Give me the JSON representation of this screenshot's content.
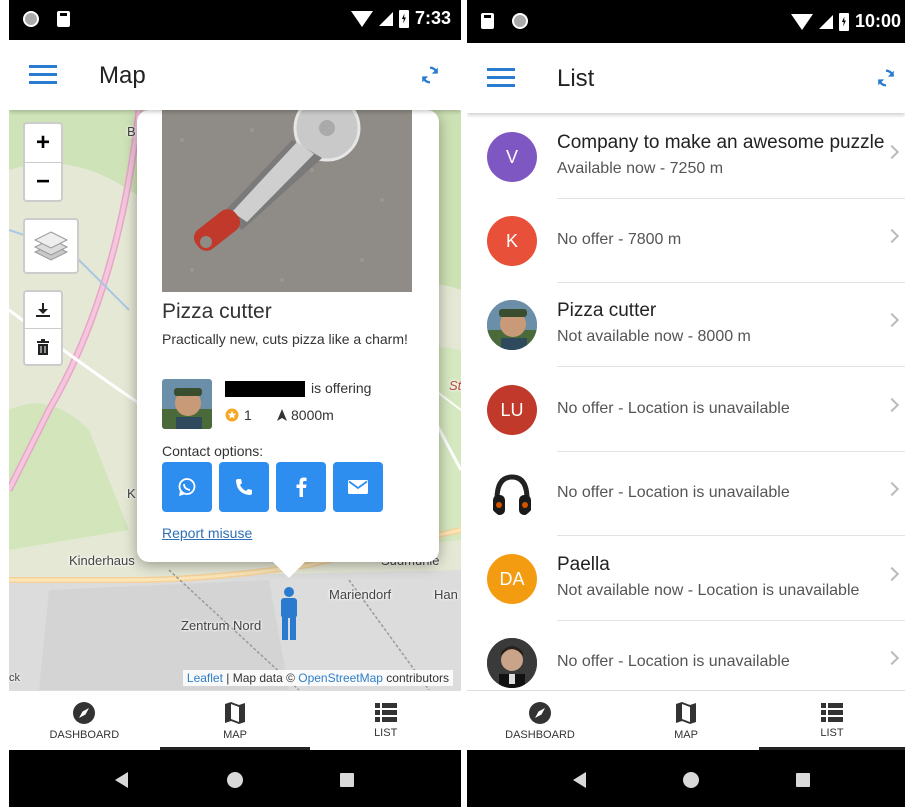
{
  "left": {
    "status": {
      "time": "7:33"
    },
    "appbar": {
      "title": "Map"
    },
    "map": {
      "zoom_in": "+",
      "zoom_out": "−",
      "labels": {
        "kinderhaus": "Kinderhaus",
        "zentrum": "Zentrum Nord",
        "mariendorf": "Mariendorf",
        "han": "Han",
        "sudmuhle": "Sudmühle",
        "b": "B",
        "k": "K",
        "st": "St",
        "ck": "ck"
      },
      "attribution": {
        "leaflet": "Leaflet",
        "sep": " | Map data © ",
        "osm": "OpenStreetMap",
        "tail": " contributors"
      }
    },
    "popup": {
      "title": "Pizza cutter",
      "description": "Practically new, cuts pizza like a charm!",
      "offering": "is offering",
      "rating": "1",
      "distance": "8000m",
      "contact_label": "Contact options:",
      "contact_buttons": [
        "whatsapp-icon",
        "phone-icon",
        "facebook-icon",
        "email-icon"
      ],
      "report": "Report misuse"
    }
  },
  "right": {
    "status": {
      "time": "10:00"
    },
    "appbar": {
      "title": "List"
    },
    "items": [
      {
        "initials": "V",
        "color": "#7e57c2",
        "title": "Company to make an awesome puzzle",
        "subtitle": "Available now - 7250 m"
      },
      {
        "initials": "K",
        "color": "#e8503a",
        "title": "",
        "subtitle": "No offer - 7800 m"
      },
      {
        "initials": "",
        "color": "#5a7a4a",
        "title": "Pizza cutter",
        "subtitle": "Not available now - 8000 m"
      },
      {
        "initials": "LU",
        "color": "#c0392b",
        "title": "",
        "subtitle": "No offer - Location is unavailable"
      },
      {
        "initials": "",
        "color": "#ffffff",
        "title": "",
        "subtitle": "No offer - Location is unavailable"
      },
      {
        "initials": "DA",
        "color": "#f39c12",
        "title": "Paella",
        "subtitle": "Not available now - Location is unavailable"
      },
      {
        "initials": "",
        "color": "#333333",
        "title": "",
        "subtitle": "No offer - Location is unavailable"
      }
    ]
  },
  "nav": {
    "dashboard": "DASHBOARD",
    "map": "MAP",
    "list": "LIST"
  },
  "colors": {
    "accent": "#2a7bd0",
    "button": "#2d8ef0"
  }
}
